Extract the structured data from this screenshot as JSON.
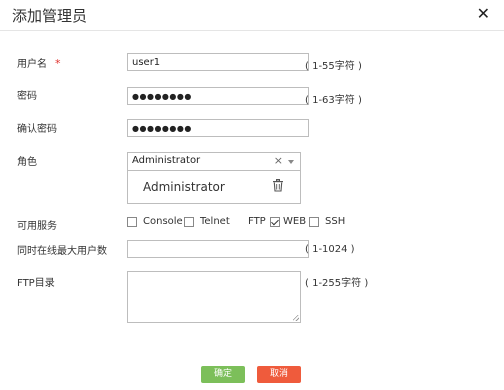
{
  "dialog": {
    "title": "添加管理员",
    "close_glyph": "✕"
  },
  "username": {
    "label": "用户名",
    "required_mark": "*",
    "value": "user1",
    "hint": "( 1-55字符 )"
  },
  "password": {
    "label": "密码",
    "value": "●●●●●●●●",
    "hint": "( 1-63字符 )"
  },
  "confirm_password": {
    "label": "确认密码",
    "value": "●●●●●●●●"
  },
  "role": {
    "label": "角色",
    "selected": "Administrator",
    "clear_glyph": "×",
    "items": [
      "Administrator"
    ]
  },
  "services": {
    "label": "可用服务",
    "options": [
      {
        "name": "Console",
        "checked": false
      },
      {
        "name": "Telnet",
        "checked": false
      },
      {
        "name": "FTP",
        "checked": true
      },
      {
        "name": "WEB",
        "checked": false
      },
      {
        "name": "SSH",
        "checked": false
      }
    ]
  },
  "max_online": {
    "label": "同时在线最大用户数",
    "value": "",
    "hint": "( 1-1024 )"
  },
  "ftp_dir": {
    "label": "FTP目录",
    "value": "",
    "hint": "( 1-255字符 )"
  },
  "buttons": {
    "ok": "确定",
    "cancel": "取消"
  },
  "colors": {
    "ok": "#7cbf5a",
    "cancel": "#ef5b3c",
    "required": "#e0302c"
  }
}
